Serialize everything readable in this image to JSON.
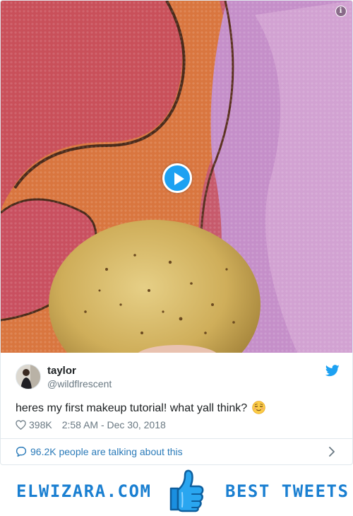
{
  "tweet": {
    "author": {
      "display_name": "taylor",
      "handle": "@wildflrescent"
    },
    "text": "heres my first makeup tutorial! what yall think?",
    "emoji": "relieved-face",
    "likes": "398K",
    "timestamp": "2:58 AM - Dec 30, 2018",
    "conversation": "96.2K people are talking about this"
  },
  "banner": {
    "site": "ELWIZARA.COM",
    "tagline": "BEST TWEETS"
  },
  "colors": {
    "twitter_blue": "#1da1f2",
    "link_blue": "#2b7bb9",
    "banner_blue": "#1a7fd1",
    "text_dark": "#1c2022",
    "text_grey": "#697882"
  },
  "icons": [
    "play-icon",
    "info-icon",
    "twitter-bird-icon",
    "heart-icon",
    "speech-bubble-icon",
    "chevron-right-icon",
    "thumbs-up-icon"
  ]
}
